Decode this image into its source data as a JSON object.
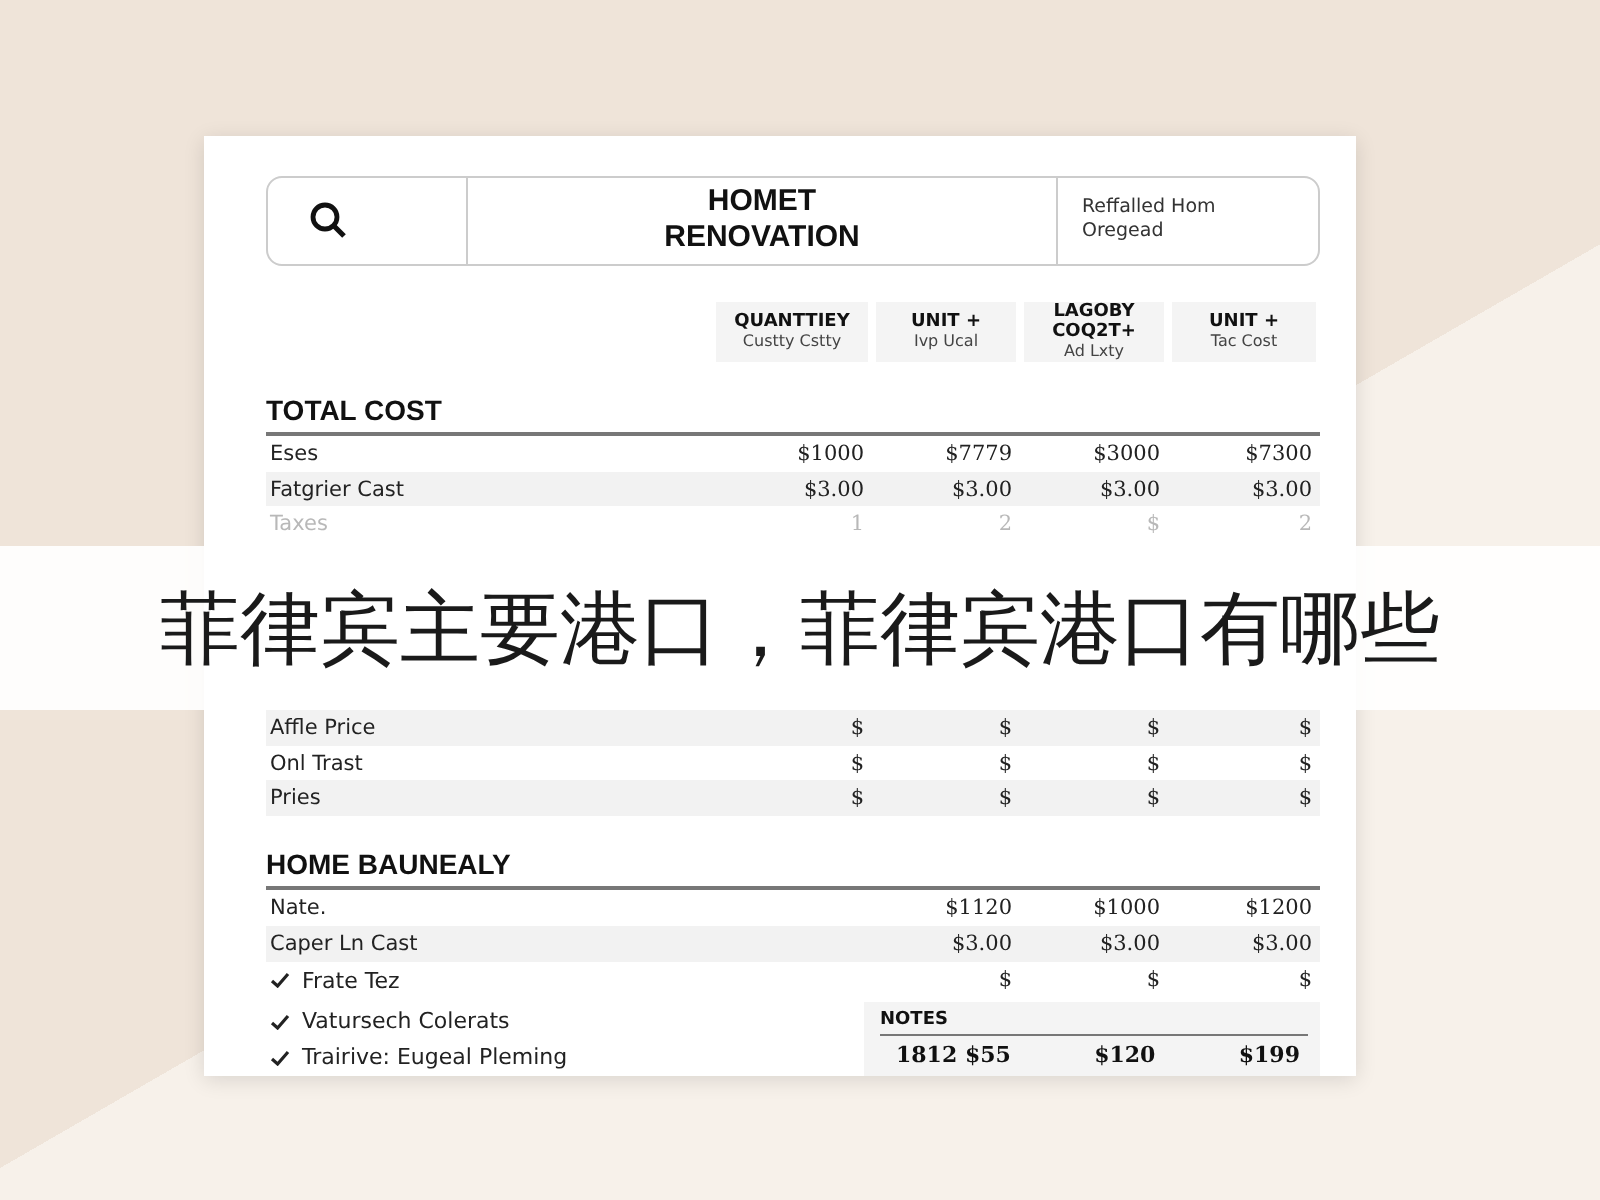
{
  "header": {
    "title": "HOMET RENOVATION",
    "note": "Reffalled Hom Oregead"
  },
  "columns": [
    {
      "label": "QUANTTIEY",
      "sub": "Custty Cstty"
    },
    {
      "label": "UNIT +",
      "sub": "Ivp Ucal"
    },
    {
      "label": "LAGOBY COQ2T+",
      "sub": "Ad Lxty"
    },
    {
      "label": "UNIT +",
      "sub": "Tac Cost"
    }
  ],
  "total_cost": {
    "title": "TOTAL COST",
    "rows": [
      {
        "label": "Eses",
        "values": [
          "$1000",
          "$7779",
          "$3000",
          "$7300"
        ],
        "faded": false
      },
      {
        "label": "Fatgrier Cast",
        "values": [
          "$3.00",
          "$3.00",
          "$3.00",
          "$3.00"
        ],
        "faded": false
      },
      {
        "label": "Taxes",
        "values": [
          "1",
          "2",
          "$",
          "2"
        ],
        "faded": true
      },
      {
        "label": "Affle Price",
        "values": [
          "$",
          "$",
          "$",
          "$"
        ],
        "faded": false
      },
      {
        "label": "Onl Trast",
        "values": [
          "$",
          "$",
          "$",
          "$"
        ],
        "faded": false
      },
      {
        "label": "Pries",
        "values": [
          "$",
          "$",
          "$",
          "$"
        ],
        "faded": false
      }
    ]
  },
  "banner": {
    "text": "菲律宾主要港口，菲律宾港口有哪些"
  },
  "home_section": {
    "title": "HOME BAUNEALY",
    "rows": [
      {
        "kind": "plain",
        "label": "Nate.",
        "values": [
          "$1120",
          "$1000",
          "$1200"
        ]
      },
      {
        "kind": "plain",
        "label": "Caper Ln Cast",
        "values": [
          "$3.00",
          "$3.00",
          "$3.00"
        ]
      },
      {
        "kind": "check",
        "label": "Frate Tez",
        "values": [
          "$",
          "$",
          "$"
        ]
      }
    ],
    "checklist": [
      "Vatursech Colerats",
      "Trairive: Eugeal Pleming"
    ]
  },
  "notes": {
    "title": "NOTES",
    "values": [
      "1812 $55",
      "$120",
      "$199"
    ]
  }
}
